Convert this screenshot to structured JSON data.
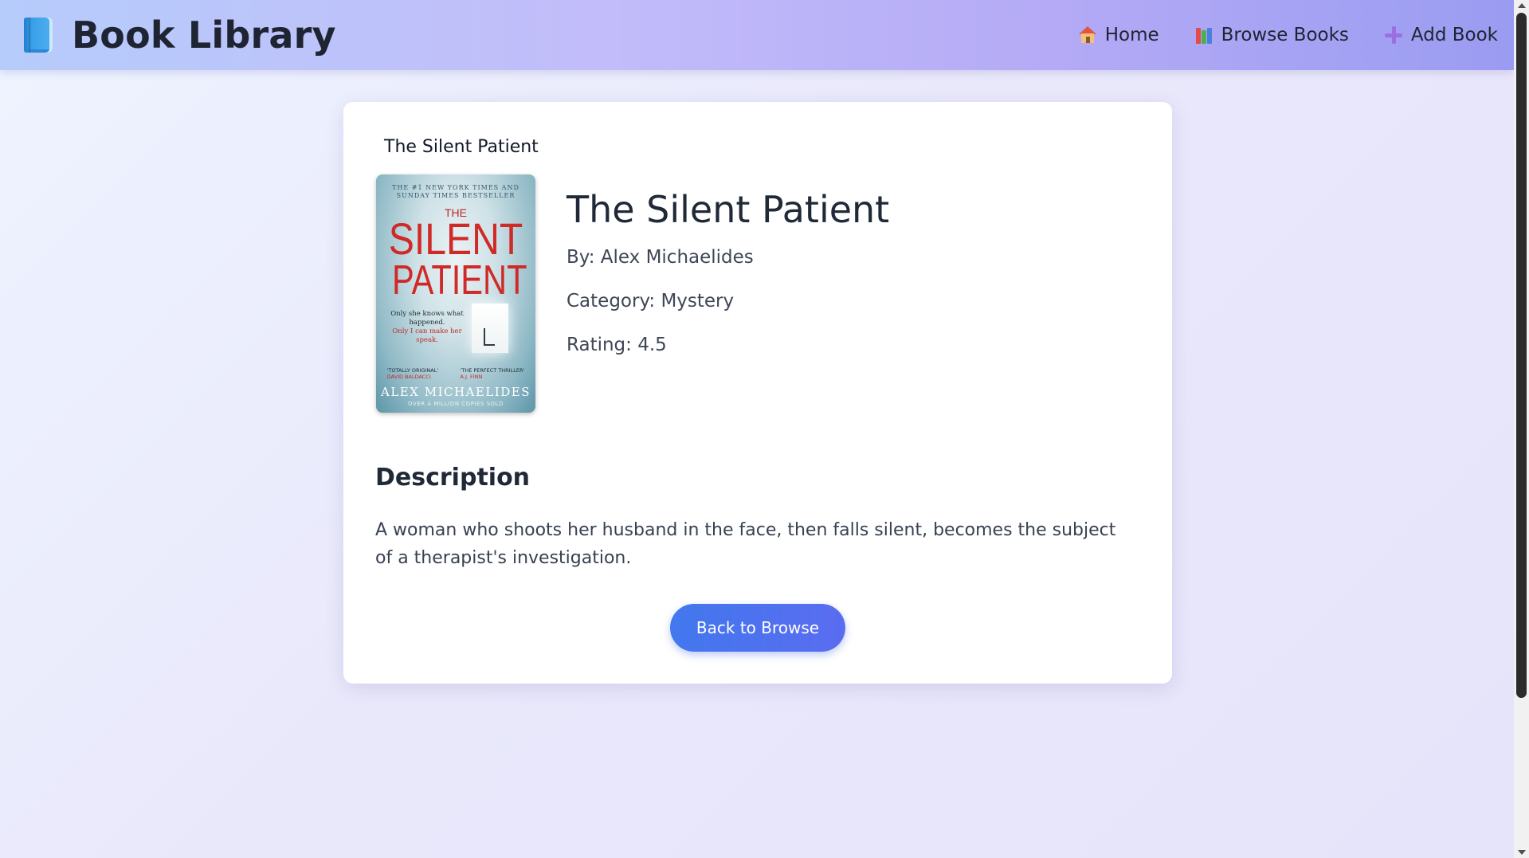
{
  "header": {
    "brand_title": "Book Library",
    "brand_icon": "blue-book-icon",
    "nav": [
      {
        "label": "Home",
        "icon": "house-icon"
      },
      {
        "label": "Browse Books",
        "icon": "books-icon"
      },
      {
        "label": "Add Book",
        "icon": "plus-icon"
      }
    ]
  },
  "book": {
    "cover_caption": "The Silent Patient",
    "cover": {
      "top_text": "THE #1 NEW YORK TIMES AND SUNDAY TIMES BESTSELLER",
      "the": "THE",
      "word1": "SILENT",
      "word2": "PATIENT",
      "tagline_1": "Only she knows what happened.",
      "tagline_2": "Only I can make her speak.",
      "quote_left_1": "'TOTALLY ORIGINAL'",
      "quote_left_2": "DAVID BALDACCI",
      "quote_right_1": "'THE PERFECT THRILLER'",
      "quote_right_2": "A.J. FINN",
      "author": "ALEX MICHAELIDES",
      "sub": "OVER A MILLION COPIES SOLD"
    },
    "title": "The Silent Patient",
    "author_line": "By: Alex Michaelides",
    "category_line": "Category: Mystery",
    "rating_line": "Rating: 4.5"
  },
  "description": {
    "heading": "Description",
    "text": "A woman who shoots her husband in the face, then falls silent, becomes the subject of a therapist's investigation."
  },
  "actions": {
    "back_label": "Back to Browse"
  },
  "colors": {
    "accent": "#4278ee",
    "header_start": "#b6ccfb",
    "header_end": "#9a9cf1"
  }
}
